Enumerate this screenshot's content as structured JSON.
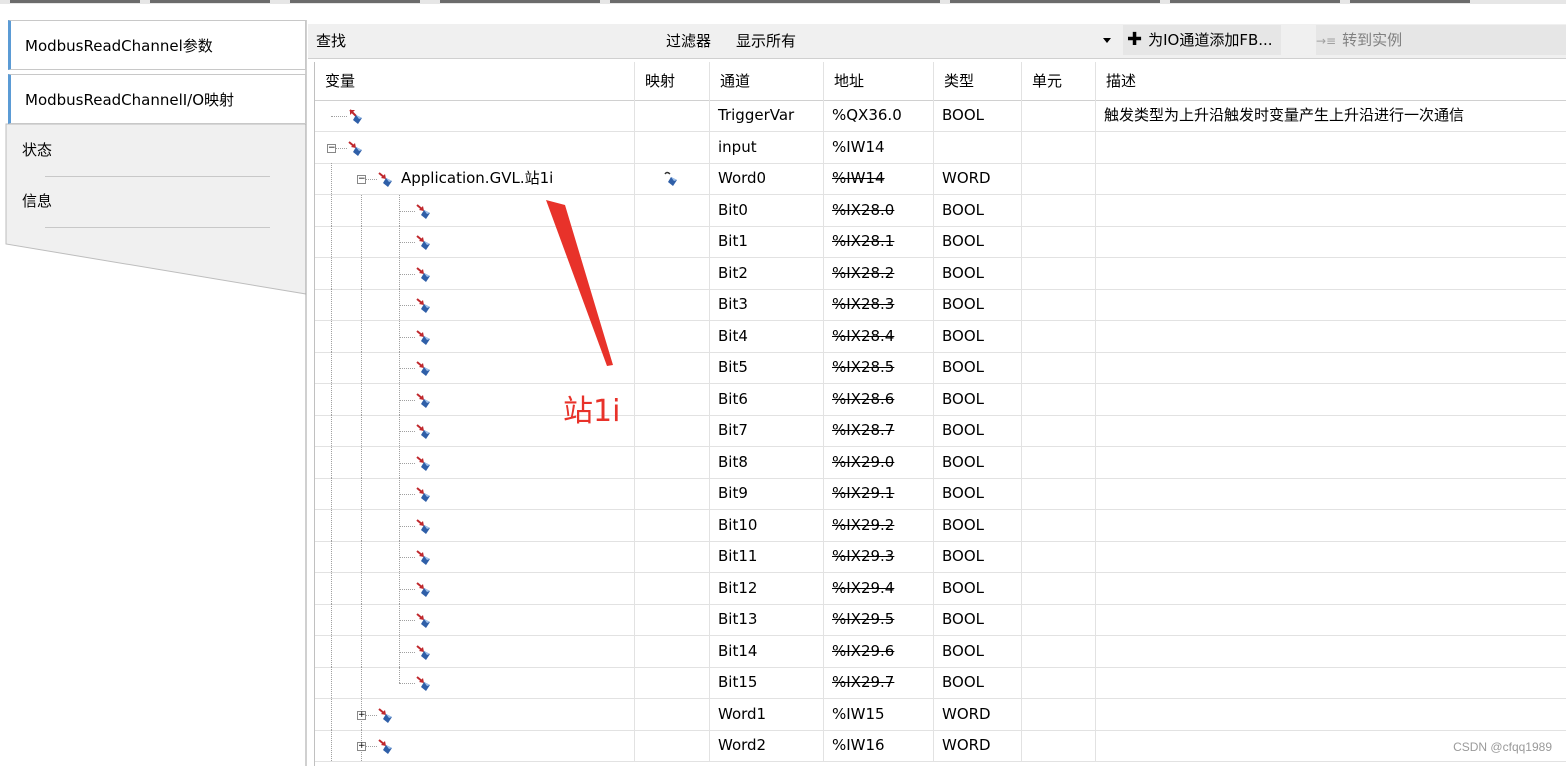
{
  "tabs": [
    {
      "label": "ModbusReadChannel参数"
    },
    {
      "label": "ModbusReadChannelI/O映射"
    },
    {
      "label": "状态"
    },
    {
      "label": "信息"
    }
  ],
  "toolbar": {
    "find_label": "查找",
    "find_value": "",
    "filter_label": "过滤器",
    "filter_value": "显示所有",
    "add_fb_label": "为IO通道添加FB...",
    "goto_instance_label": "转到实例"
  },
  "columns": [
    "变量",
    "映射",
    "通道",
    "地址",
    "类型",
    "单元",
    "描述"
  ],
  "rows": [
    {
      "var": "",
      "expander": "",
      "level": 0,
      "mapped": false,
      "channel": "TriggerVar",
      "address": "%QX36.0",
      "type": "BOOL",
      "unit": "",
      "desc": "触发类型为上升沿触发时变量产生上升沿进行一次通信",
      "strike": false,
      "icon": "output-var-icon"
    },
    {
      "var": "",
      "expander": "−",
      "level": 0,
      "mapped": false,
      "channel": "input",
      "address": "%IW14",
      "type": "",
      "unit": "",
      "desc": "",
      "strike": false,
      "icon": "input-var-icon"
    },
    {
      "var": "Application.GVL.站1i",
      "expander": "−",
      "level": 1,
      "mapped": true,
      "channel": "Word0",
      "address": "%IW14",
      "type": "WORD",
      "unit": "",
      "desc": "",
      "strike": true,
      "icon": "input-var-icon"
    },
    {
      "var": "",
      "expander": "",
      "level": 2,
      "mapped": false,
      "channel": "Bit0",
      "address": "%IX28.0",
      "type": "BOOL",
      "unit": "",
      "desc": "",
      "strike": true,
      "icon": "input-var-icon"
    },
    {
      "var": "",
      "expander": "",
      "level": 2,
      "mapped": false,
      "channel": "Bit1",
      "address": "%IX28.1",
      "type": "BOOL",
      "unit": "",
      "desc": "",
      "strike": true,
      "icon": "input-var-icon"
    },
    {
      "var": "",
      "expander": "",
      "level": 2,
      "mapped": false,
      "channel": "Bit2",
      "address": "%IX28.2",
      "type": "BOOL",
      "unit": "",
      "desc": "",
      "strike": true,
      "icon": "input-var-icon"
    },
    {
      "var": "",
      "expander": "",
      "level": 2,
      "mapped": false,
      "channel": "Bit3",
      "address": "%IX28.3",
      "type": "BOOL",
      "unit": "",
      "desc": "",
      "strike": true,
      "icon": "input-var-icon"
    },
    {
      "var": "",
      "expander": "",
      "level": 2,
      "mapped": false,
      "channel": "Bit4",
      "address": "%IX28.4",
      "type": "BOOL",
      "unit": "",
      "desc": "",
      "strike": true,
      "icon": "input-var-icon"
    },
    {
      "var": "",
      "expander": "",
      "level": 2,
      "mapped": false,
      "channel": "Bit5",
      "address": "%IX28.5",
      "type": "BOOL",
      "unit": "",
      "desc": "",
      "strike": true,
      "icon": "input-var-icon"
    },
    {
      "var": "",
      "expander": "",
      "level": 2,
      "mapped": false,
      "channel": "Bit6",
      "address": "%IX28.6",
      "type": "BOOL",
      "unit": "",
      "desc": "",
      "strike": true,
      "icon": "input-var-icon"
    },
    {
      "var": "",
      "expander": "",
      "level": 2,
      "mapped": false,
      "channel": "Bit7",
      "address": "%IX28.7",
      "type": "BOOL",
      "unit": "",
      "desc": "",
      "strike": true,
      "icon": "input-var-icon"
    },
    {
      "var": "",
      "expander": "",
      "level": 2,
      "mapped": false,
      "channel": "Bit8",
      "address": "%IX29.0",
      "type": "BOOL",
      "unit": "",
      "desc": "",
      "strike": true,
      "icon": "input-var-icon"
    },
    {
      "var": "",
      "expander": "",
      "level": 2,
      "mapped": false,
      "channel": "Bit9",
      "address": "%IX29.1",
      "type": "BOOL",
      "unit": "",
      "desc": "",
      "strike": true,
      "icon": "input-var-icon"
    },
    {
      "var": "",
      "expander": "",
      "level": 2,
      "mapped": false,
      "channel": "Bit10",
      "address": "%IX29.2",
      "type": "BOOL",
      "unit": "",
      "desc": "",
      "strike": true,
      "icon": "input-var-icon"
    },
    {
      "var": "",
      "expander": "",
      "level": 2,
      "mapped": false,
      "channel": "Bit11",
      "address": "%IX29.3",
      "type": "BOOL",
      "unit": "",
      "desc": "",
      "strike": true,
      "icon": "input-var-icon"
    },
    {
      "var": "",
      "expander": "",
      "level": 2,
      "mapped": false,
      "channel": "Bit12",
      "address": "%IX29.4",
      "type": "BOOL",
      "unit": "",
      "desc": "",
      "strike": true,
      "icon": "input-var-icon"
    },
    {
      "var": "",
      "expander": "",
      "level": 2,
      "mapped": false,
      "channel": "Bit13",
      "address": "%IX29.5",
      "type": "BOOL",
      "unit": "",
      "desc": "",
      "strike": true,
      "icon": "input-var-icon"
    },
    {
      "var": "",
      "expander": "",
      "level": 2,
      "mapped": false,
      "channel": "Bit14",
      "address": "%IX29.6",
      "type": "BOOL",
      "unit": "",
      "desc": "",
      "strike": true,
      "icon": "input-var-icon"
    },
    {
      "var": "",
      "expander": "",
      "level": 2,
      "mapped": false,
      "channel": "Bit15",
      "address": "%IX29.7",
      "type": "BOOL",
      "unit": "",
      "desc": "",
      "strike": true,
      "icon": "input-var-icon"
    },
    {
      "var": "",
      "expander": "+",
      "level": 1,
      "mapped": false,
      "channel": "Word1",
      "address": "%IW15",
      "type": "WORD",
      "unit": "",
      "desc": "",
      "strike": false,
      "icon": "input-var-icon"
    },
    {
      "var": "",
      "expander": "+",
      "level": 1,
      "mapped": false,
      "channel": "Word2",
      "address": "%IW16",
      "type": "WORD",
      "unit": "",
      "desc": "",
      "strike": false,
      "icon": "input-var-icon"
    }
  ],
  "annotation": {
    "label": "站1i",
    "color": "#e8322a"
  },
  "watermark": "CSDN @cfqq1989",
  "colors": {
    "accent": "#5b9bd5",
    "icon_red": "#c0282d",
    "icon_blue": "#2f5fa8"
  }
}
